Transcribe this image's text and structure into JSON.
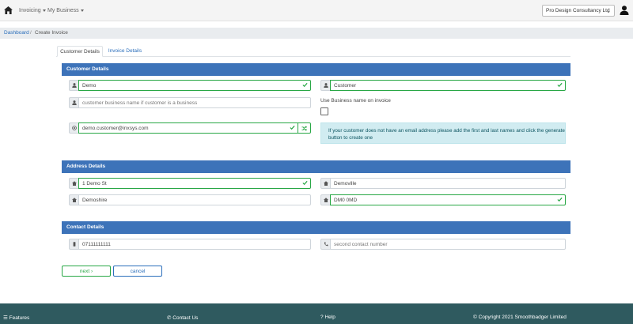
{
  "nav": {
    "invoicing": "Invoicing",
    "my_business": "My Business",
    "company": "Pro Design Consultancy Ltd"
  },
  "breadcrumb": {
    "dashboard": "Dashboard",
    "separator": "/",
    "current": "Create Invoice"
  },
  "tabs": {
    "customer": "Customer Details",
    "invoice": "Invoice Details"
  },
  "customer_section": {
    "title": "Customer Details",
    "first_name": "Demo",
    "last_name": "Customer",
    "business_placeholder": "customer business name if customer is a business",
    "use_business_label": "Use Business name on invoice",
    "email": "demo.customer@inxsys.com",
    "info": "If your customer does not have an email address please add the first and last names and click the generate button to create one"
  },
  "address_section": {
    "title": "Address Details",
    "line1": "1 Demo St",
    "town": "Demoville",
    "county": "Demoshire",
    "postcode": "DM0 0MD"
  },
  "contact_section": {
    "title": "Contact Details",
    "phone": "07111111111",
    "phone2_placeholder": "second contact number"
  },
  "actions": {
    "next": "next",
    "cancel": "cancel"
  },
  "footer": {
    "features": "Features",
    "contact": "Contact Us",
    "help": "Help",
    "copyright": "Copyright 2021 Smoothbadger Limited"
  },
  "colors": {
    "section_header": "#3d73b9",
    "valid": "#28a745",
    "footer": "#2f5a5f",
    "info_bg": "#d1ecf1"
  }
}
